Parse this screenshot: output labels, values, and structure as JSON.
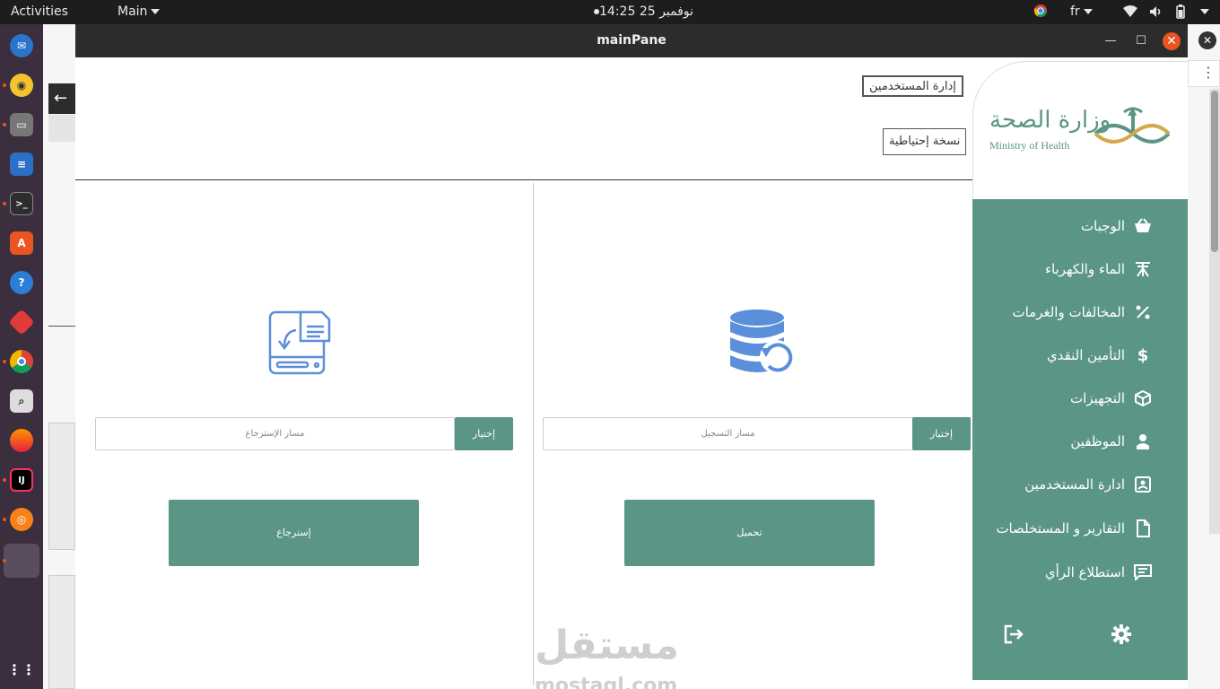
{
  "topbar": {
    "activities": "Activities",
    "app_menu": "Main",
    "clock": "نوفمبر 25  14:25",
    "language": "fr"
  },
  "window": {
    "title": "mainPane"
  },
  "tabs": {
    "user_admin": "إدارة المستخدمين",
    "backup": "نسخة إحتياطية"
  },
  "backup_panel": {
    "path_placeholder": "مسار التسجيل",
    "choose_label": "إختيار",
    "action_label": "تحميل"
  },
  "restore_panel": {
    "path_placeholder": "مسار الإسترجاع",
    "choose_label": "إختيار",
    "action_label": "إسترجاع"
  },
  "logo": {
    "arabic": "وزارة الصحة",
    "english": "Ministry of Health"
  },
  "sidebar": {
    "items": [
      {
        "label": "الوجبات",
        "icon": "basket-icon"
      },
      {
        "label": "الماء والكهرباء",
        "icon": "utility-pole-icon"
      },
      {
        "label": "المخالفات والغرمات",
        "icon": "percent-icon"
      },
      {
        "label": "التأمين النقدي",
        "icon": "dollar-icon"
      },
      {
        "label": "التجهيزات",
        "icon": "cube-icon"
      },
      {
        "label": "الموظفين",
        "icon": "employee-icon"
      },
      {
        "label": "ادارة المستخدمين",
        "icon": "user-card-icon"
      },
      {
        "label": "التقارير و المستخلصات",
        "icon": "file-icon"
      },
      {
        "label": "استطلاع الرأي",
        "icon": "chat-icon"
      }
    ]
  },
  "watermark": {
    "arabic": "مستقل",
    "latin": "mostaql.com"
  },
  "colors": {
    "accent": "#5a9585",
    "icon_blue": "#5b8fd9",
    "ubuntu_orange": "#e95420"
  }
}
